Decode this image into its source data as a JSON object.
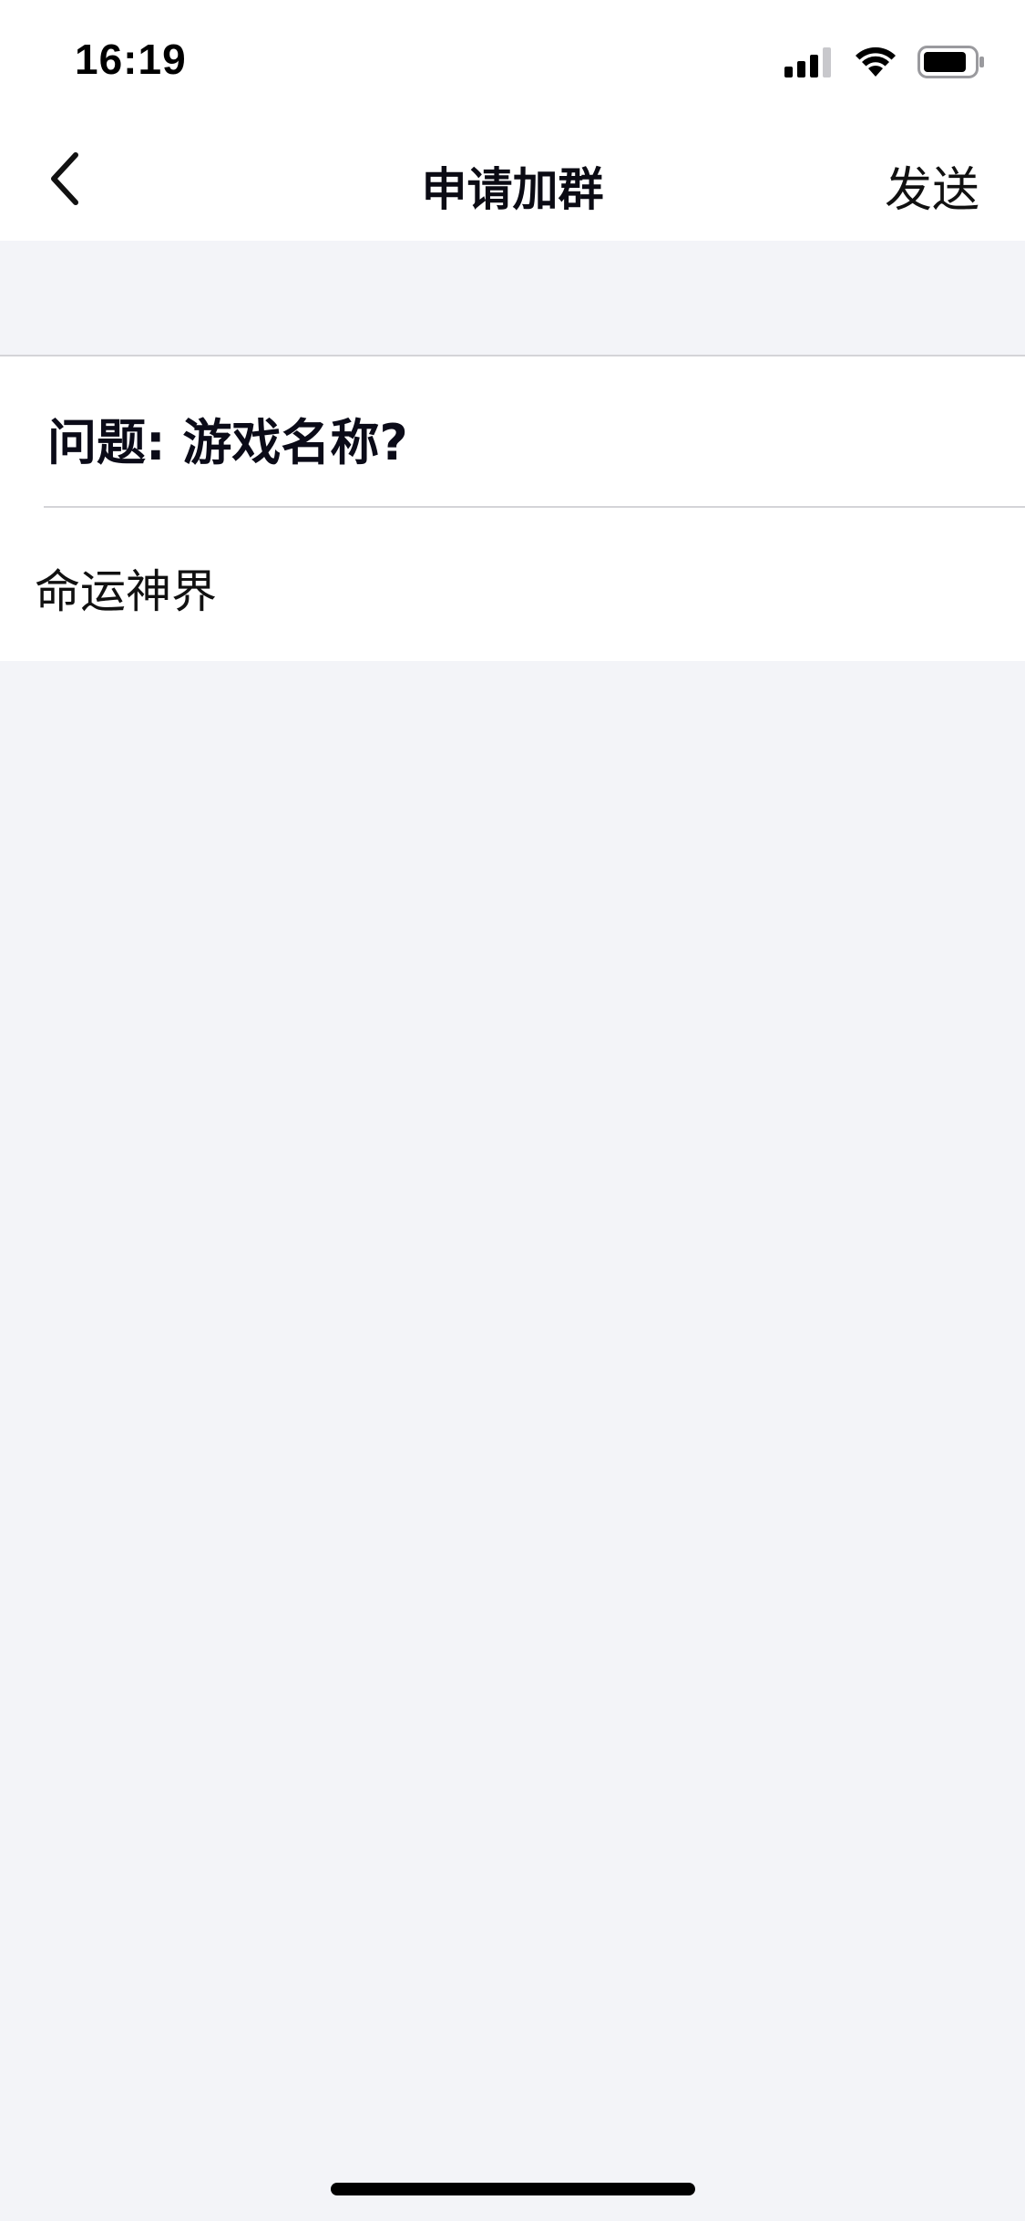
{
  "status_bar": {
    "time": "16:19"
  },
  "nav": {
    "title": "申请加群",
    "send_label": "发送"
  },
  "form": {
    "question": "问题: 游戏名称?",
    "answer_value": "命运神界"
  },
  "icons": {
    "back": "chevron-left-icon",
    "signal": "cellular-signal-icon",
    "wifi": "wifi-icon",
    "battery": "battery-icon"
  }
}
